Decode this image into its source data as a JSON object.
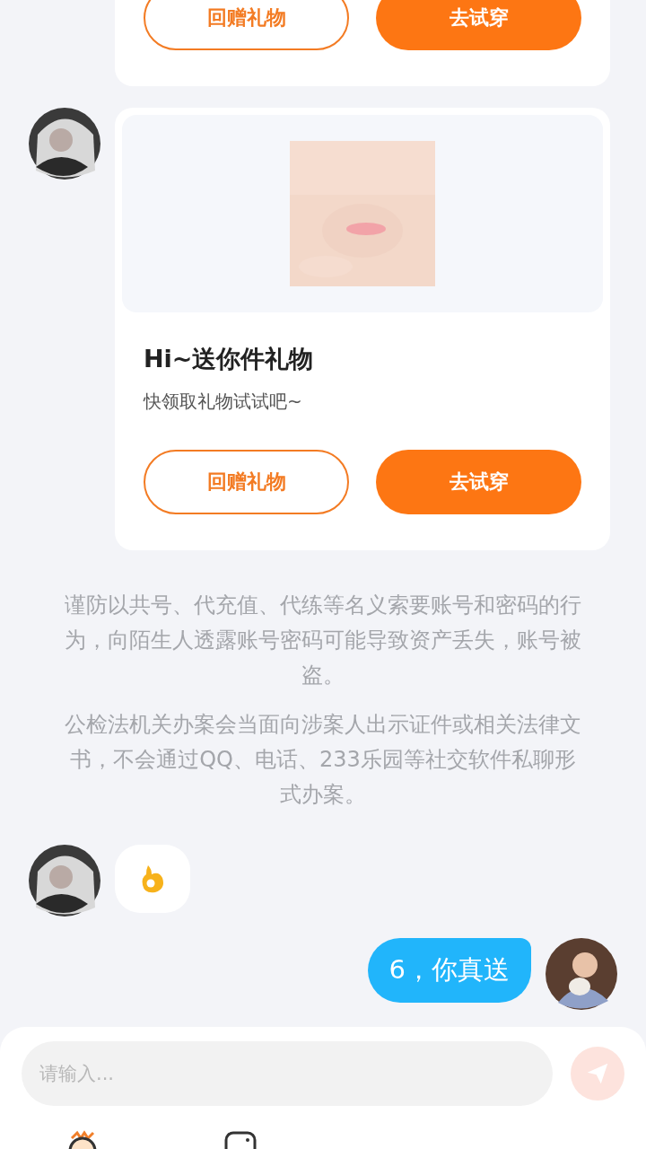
{
  "messages": [
    {
      "kind": "gift",
      "avatar": false,
      "picture": false,
      "buttons": [
        {
          "label": "回赠礼物",
          "kind": "outline"
        },
        {
          "label": "去试穿",
          "kind": "filled"
        }
      ]
    },
    {
      "kind": "gift",
      "avatar": true,
      "picture": true,
      "title": "Hi~送你件礼物",
      "subtitle": "快领取礼物试试吧~",
      "buttons": [
        {
          "label": "回赠礼物",
          "kind": "outline"
        },
        {
          "label": "去试穿",
          "kind": "filled"
        }
      ]
    },
    {
      "kind": "notice",
      "paragraphs": [
        "谨防以共号、代充值、代练等名义索要账号和密码的行为，向陌生人透露账号密码可能导致资产丢失，账号被盗。",
        "公检法机关办案会当面向涉案人出示证件或相关法律文书，不会通过QQ、电话、233乐园等社交软件私聊形式办案。"
      ]
    },
    {
      "kind": "sticker",
      "avatar": true
    },
    {
      "kind": "text",
      "avatar": true,
      "text": "6，你真送"
    }
  ],
  "composer": {
    "placeholder": "请输入...",
    "send_disabled": true
  },
  "toolbar": [
    {
      "kind": "character"
    },
    {
      "kind": "gamepad"
    }
  ]
}
